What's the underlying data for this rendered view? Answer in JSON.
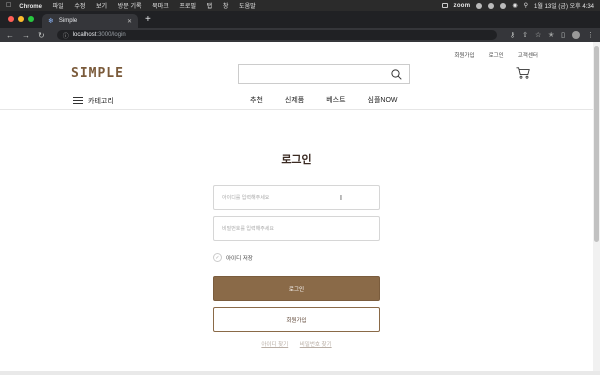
{
  "macos": {
    "app_name": "Chrome",
    "menu": [
      "파일",
      "수정",
      "보기",
      "방문 기록",
      "북마크",
      "프로필",
      "탭",
      "창",
      "도움말"
    ],
    "zoom_label": "zoom",
    "datetime": "1월 13일 (금) 오후 4:34"
  },
  "browser": {
    "tab_title": "Simple",
    "new_tab_label": "+",
    "url_host": "localhost",
    "url_path": ":3000/login",
    "light_colors": [
      "#ff5f57",
      "#febc2e",
      "#28c840"
    ]
  },
  "header": {
    "top_links": [
      "회원가입",
      "로그인",
      "고객센터"
    ],
    "logo": "SIMPLE",
    "search_placeholder": "",
    "category_label": "카테고리",
    "nav": [
      "추천",
      "신제품",
      "베스트",
      "심플NOW"
    ]
  },
  "login": {
    "title": "로그인",
    "email_placeholder": "아이디를 입력해주세요",
    "password_placeholder": "비밀번호를 입력해주세요",
    "remember_label": "아이디 저장",
    "login_button": "로그인",
    "join_button": "회원가입",
    "find_links": [
      "아이디 찾기",
      "비밀번호 찾기"
    ]
  },
  "colors": {
    "brand": "#7a5a3a",
    "login_button_bg": "#8a6a48"
  }
}
